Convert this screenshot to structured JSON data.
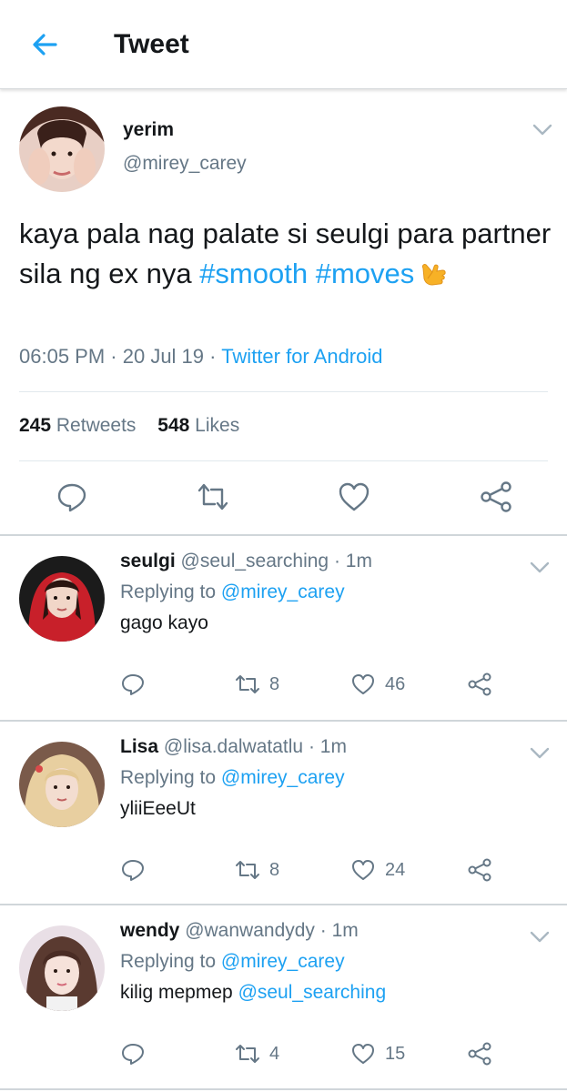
{
  "header": {
    "title": "Tweet",
    "back_icon": "arrow-left-icon",
    "accent": "#1da1f2"
  },
  "tweet": {
    "name": "yerim",
    "handle": "@mirey_carey",
    "text_plain": "kaya pala nag palate si seulgi para partner sila ng ex nya",
    "hashtag1": "#smooth",
    "hashtag2": "#moves",
    "emoji": "call-me-hand-emoji",
    "time": "06:05 PM",
    "dot1": " · ",
    "date": "20 Jul 19",
    "dot2": " · ",
    "source": "Twitter for Android",
    "retweets_count": "245",
    "retweets_label": "Retweets",
    "likes_count": "548",
    "likes_label": "Likes",
    "actions": [
      "reply-icon",
      "retweet-icon",
      "like-icon",
      "share-icon"
    ]
  },
  "replies": [
    {
      "name": "seulgi",
      "handle": "@seul_searching",
      "dot": " · ",
      "time": "1m",
      "replying_prefix": "Replying to ",
      "replying_to": "@mirey_carey",
      "text": "gago kayo",
      "text_mention": "",
      "retweets": "8",
      "likes": "46"
    },
    {
      "name": "Lisa",
      "handle": "@lisa.dalwatatlu",
      "dot": " · ",
      "time": "1m",
      "replying_prefix": "Replying to ",
      "replying_to": "@mirey_carey",
      "text": "yliiEeeUt",
      "text_mention": "",
      "retweets": "8",
      "likes": "24"
    },
    {
      "name": "wendy",
      "handle": "@wanwandydy",
      "dot": " · ",
      "time": "1m",
      "replying_prefix": "Replying to ",
      "replying_to": "@mirey_carey",
      "text": "kilig mepmep ",
      "text_mention": "@seul_searching",
      "retweets": "4",
      "likes": "15"
    }
  ]
}
